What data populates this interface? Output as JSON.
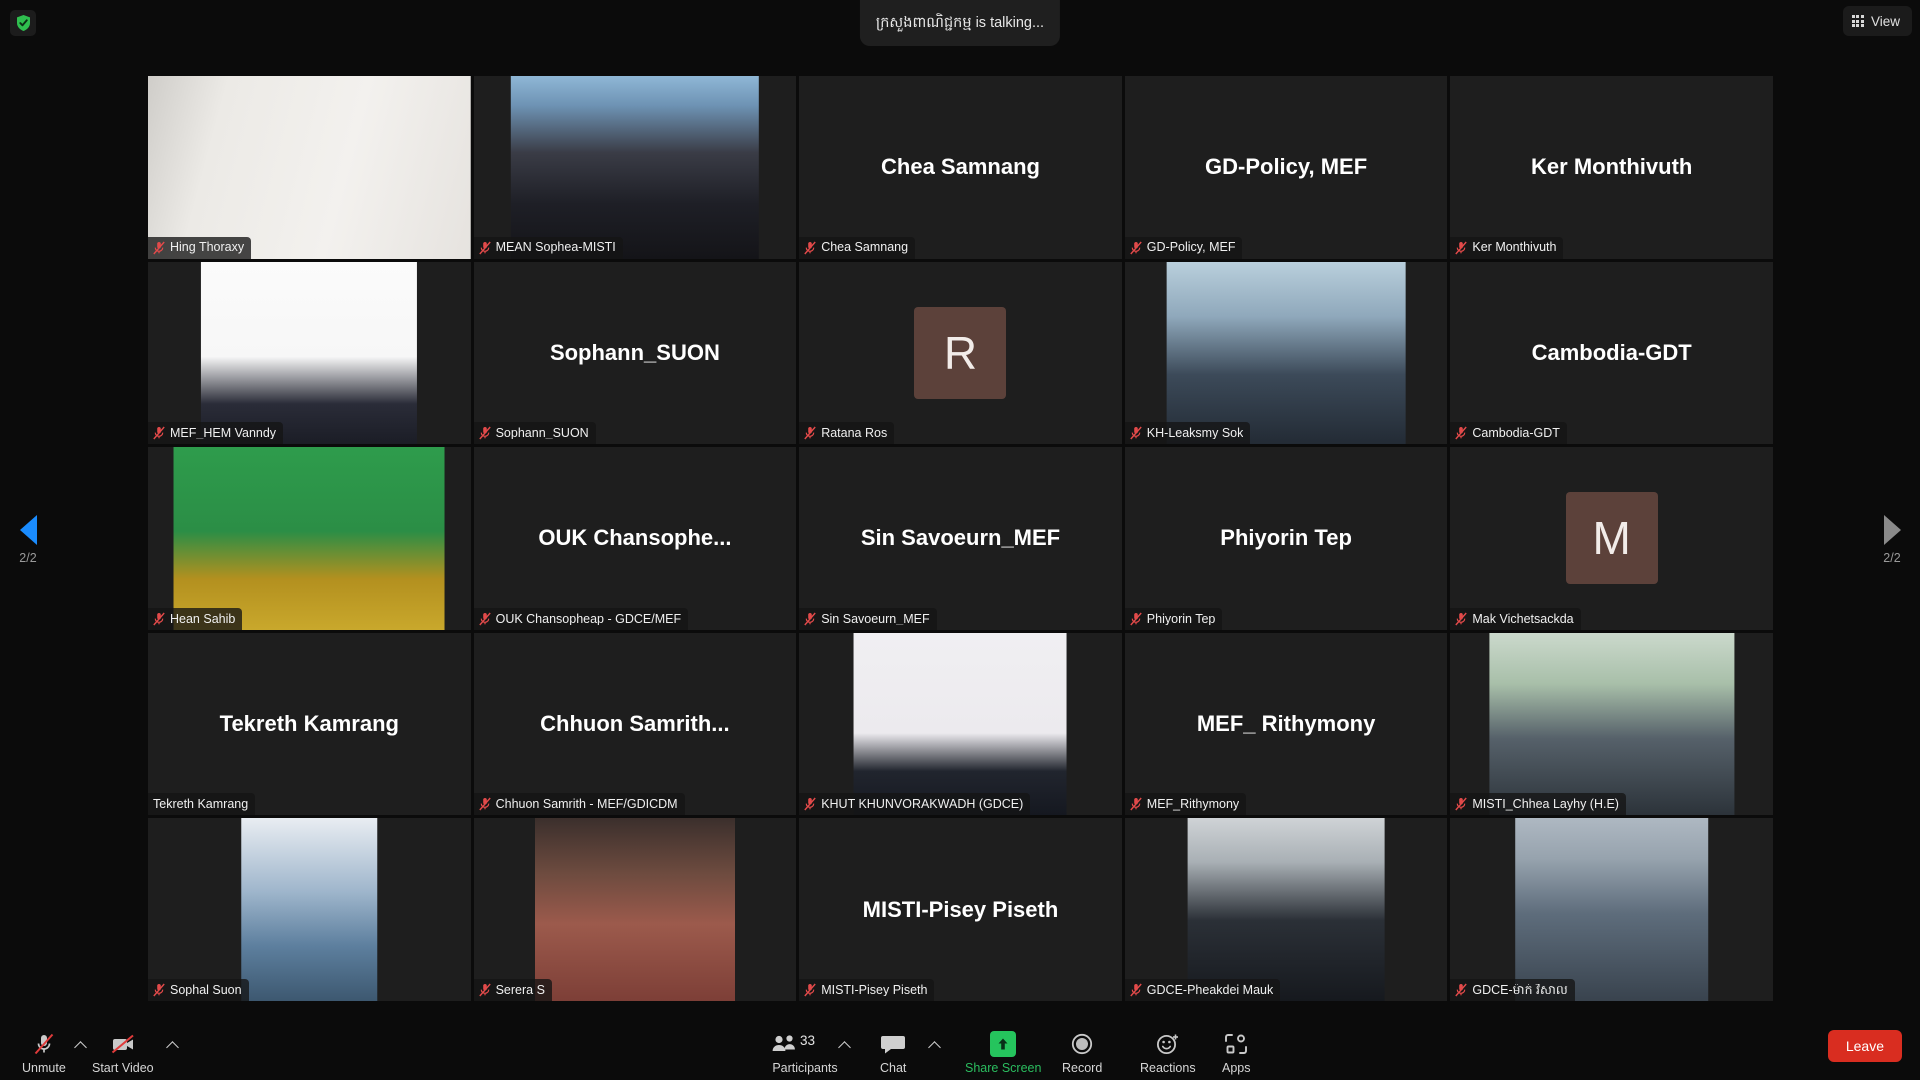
{
  "app": {
    "name": "Zoom Meeting",
    "encryption_icon": "shield-check-icon",
    "speaker_status": "ក្រសួងពាណិជ្ជកម្ម is talking...",
    "accent_green": "#25c45d",
    "leave_red": "#d92d20",
    "avatar_brown": "#5c413a",
    "pager_active_blue": "#1a8cff"
  },
  "topbar": {
    "view_label": "View",
    "view_icon": "grid-icon"
  },
  "pager": {
    "left_label": "2/2",
    "right_label": "2/2",
    "left_icon": "chevron-left-icon",
    "right_icon": "chevron-right-icon"
  },
  "gallery": {
    "columns": 5,
    "rows": 5,
    "tiles": [
      {
        "display_name": "Hing Thoraxy",
        "name_label": "Hing Thoraxy",
        "muted": true,
        "video": true,
        "video_kind": "portrait-white-room",
        "show_bigname": false
      },
      {
        "display_name": "MEAN Sophea-MISTI",
        "name_label": "MEAN Sophea-MISTI",
        "muted": true,
        "video": true,
        "video_kind": "conference-hall",
        "show_bigname": false
      },
      {
        "display_name": "Chea Samnang",
        "name_label": "Chea Samnang",
        "muted": true,
        "video": false,
        "show_bigname": true
      },
      {
        "display_name": "GD-Policy, MEF",
        "name_label": "GD-Policy, MEF",
        "muted": true,
        "video": false,
        "show_bigname": true
      },
      {
        "display_name": "Ker Monthivuth",
        "name_label": "Ker Monthivuth",
        "muted": true,
        "video": false,
        "show_bigname": true
      },
      {
        "display_name": "MEF_HEM Vanndy",
        "name_label": "MEF_HEM Vanndy",
        "muted": true,
        "video": true,
        "video_kind": "headshot-suit-white",
        "show_bigname": false
      },
      {
        "display_name": "Sophann_SUON",
        "name_label": "Sophann_SUON",
        "muted": true,
        "video": false,
        "show_bigname": true
      },
      {
        "display_name": "Ratana Ros",
        "name_label": "Ratana Ros",
        "muted": true,
        "video": false,
        "show_bigname": false,
        "avatar_letter": "R"
      },
      {
        "display_name": "KH-Leaksmy Sok",
        "name_label": "KH-Leaksmy Sok",
        "muted": true,
        "video": true,
        "video_kind": "office-woman",
        "show_bigname": false
      },
      {
        "display_name": "Cambodia-GDT",
        "name_label": "Cambodia-GDT",
        "muted": true,
        "video": false,
        "show_bigname": true
      },
      {
        "display_name": "Hean Sahib",
        "name_label": "Hean Sahib",
        "muted": true,
        "video": true,
        "video_kind": "green-backdrop-mask",
        "show_bigname": false
      },
      {
        "display_name": "OUK  Chansophe...",
        "name_label": "OUK Chansopheap - GDCE/MEF",
        "muted": true,
        "video": false,
        "show_bigname": true
      },
      {
        "display_name": "Sin Savoeurn_MEF",
        "name_label": "Sin Savoeurn_MEF",
        "muted": true,
        "video": false,
        "show_bigname": true
      },
      {
        "display_name": "Phiyorin Tep",
        "name_label": "Phiyorin Tep",
        "muted": true,
        "video": false,
        "show_bigname": true
      },
      {
        "display_name": "Mak Vichetsackda",
        "name_label": "Mak Vichetsackda",
        "muted": true,
        "video": false,
        "show_bigname": false,
        "avatar_letter": "M"
      },
      {
        "display_name": "Tekreth Kamrang",
        "name_label": "Tekreth Kamrang",
        "muted": false,
        "video": false,
        "show_bigname": true
      },
      {
        "display_name": "Chhuon  Samrith...",
        "name_label": "Chhuon Samrith - MEF/GDICDM",
        "muted": true,
        "video": false,
        "show_bigname": true
      },
      {
        "display_name": "KHUT KHUNVORAKWADH (GDCE)",
        "name_label": "KHUT KHUNVORAKWADH (GDCE)",
        "muted": true,
        "video": true,
        "video_kind": "headshot-young-man",
        "show_bigname": false
      },
      {
        "display_name": "MEF_ Rithymony",
        "name_label": "MEF_Rithymony",
        "muted": true,
        "video": false,
        "show_bigname": true
      },
      {
        "display_name": "MISTI_Chhea Layhy (H.E)",
        "name_label": "MISTI_Chhea Layhy (H.E)",
        "muted": true,
        "video": true,
        "video_kind": "office-plants-man",
        "show_bigname": false
      },
      {
        "display_name": "Sophal Suon",
        "name_label": "Sophal Suon",
        "muted": true,
        "video": true,
        "video_kind": "screen-share-small",
        "show_bigname": false
      },
      {
        "display_name": "Serera S",
        "name_label": "Serera S",
        "muted": true,
        "video": true,
        "video_kind": "podium-speaker",
        "show_bigname": false
      },
      {
        "display_name": "MISTI-Pisey Piseth",
        "name_label": "MISTI-Pisey Piseth",
        "muted": true,
        "video": false,
        "show_bigname": true
      },
      {
        "display_name": "GDCE-Pheakdei Mauk",
        "name_label": "GDCE-Pheakdei Mauk",
        "muted": true,
        "video": true,
        "video_kind": "man-glasses-dark",
        "show_bigname": false
      },
      {
        "display_name": "GDCE-ម៉ាក់ វិសាល",
        "name_label": "GDCE-ម៉ាក់ វិសាល",
        "muted": true,
        "video": true,
        "video_kind": "uniform-officer",
        "show_bigname": false
      }
    ]
  },
  "toolbar": {
    "unmute": {
      "label": "Unmute",
      "icon": "microphone-muted-icon",
      "has_caret": true
    },
    "start_video": {
      "label": "Start Video",
      "icon": "camera-off-icon",
      "has_caret": true
    },
    "participants": {
      "label": "Participants",
      "icon": "participants-icon",
      "count": "33",
      "has_caret": true
    },
    "chat": {
      "label": "Chat",
      "icon": "chat-bubble-icon",
      "has_caret": true
    },
    "share_screen": {
      "label": "Share Screen",
      "icon": "share-screen-icon",
      "has_caret": false
    },
    "record": {
      "label": "Record",
      "icon": "record-circle-icon",
      "has_caret": false
    },
    "reactions": {
      "label": "Reactions",
      "icon": "reactions-smiley-icon",
      "has_caret": false
    },
    "apps": {
      "label": "Apps",
      "icon": "apps-icon",
      "has_caret": false
    },
    "leave": {
      "label": "Leave"
    }
  }
}
